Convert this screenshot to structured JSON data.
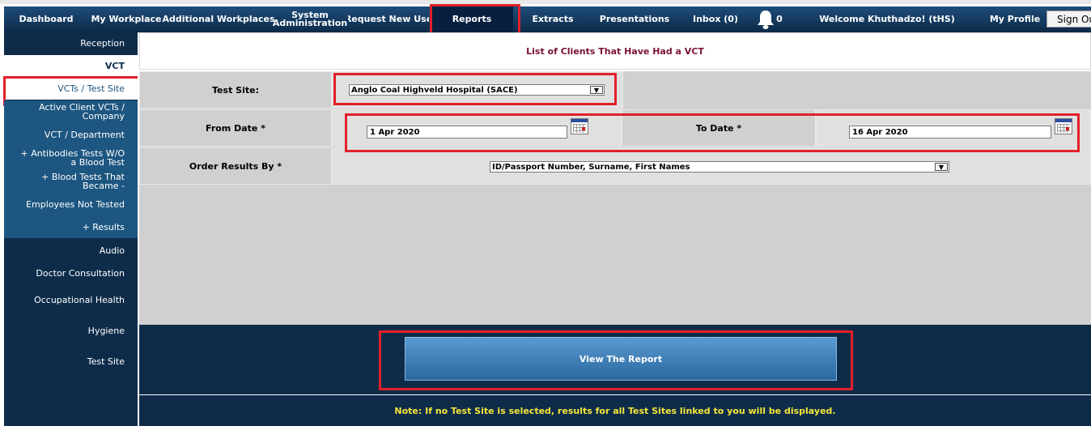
{
  "nav": {
    "items": [
      {
        "label": "Dashboard"
      },
      {
        "label": "My Workplace"
      },
      {
        "label": "Additional Workplaces"
      },
      {
        "label": "System Administration"
      },
      {
        "label": "Request New Use"
      },
      {
        "label": "Reports"
      },
      {
        "label": "Extracts"
      },
      {
        "label": "Presentations"
      },
      {
        "label": "Inbox (0)"
      },
      {
        "label": "0"
      },
      {
        "label": "Welcome Khuthadzo! (tHS)"
      },
      {
        "label": "My Profile"
      }
    ],
    "system_line1": "System",
    "system_line2": "Administration",
    "bell_count": "0",
    "signout": "Sign Ou"
  },
  "sidebar": {
    "items": [
      {
        "label": "Reception"
      },
      {
        "label": "VCT"
      },
      {
        "label": "VCTs / Test Site"
      },
      {
        "label": "Active Client VCTs / Company"
      },
      {
        "label": "VCT / Department"
      },
      {
        "label": "+ Antibodies Tests W/O a Blood Test"
      },
      {
        "label": "+ Blood Tests That Became -"
      },
      {
        "label": "Employees Not Tested"
      },
      {
        "label": "+ Results"
      },
      {
        "label": "Audio"
      },
      {
        "label": "Doctor Consultation"
      },
      {
        "label": "Occupational Health"
      },
      {
        "label": "Hygiene"
      },
      {
        "label": "Test Site"
      }
    ]
  },
  "report": {
    "title": "List of Clients That Have Had a VCT",
    "test_site_label": "Test Site:",
    "test_site_value": "Anglo Coal Highveld Hospital (SACE)",
    "from_date_label": "From Date *",
    "from_date_value": "1 Apr 2020",
    "to_date_label": "To Date *",
    "to_date_value": "16 Apr 2020",
    "order_label": "Order Results By *",
    "order_value": "ID/Passport Number, Surname, First Names",
    "view_button": "View The Report",
    "note": "Note: If no Test Site is selected, results for all Test Sites linked to you will be displayed."
  },
  "colors": {
    "nav_bg": "#0c2a48",
    "sidebar_bg": "#0e2c4a",
    "sidebar_sub_bg": "#1d5680",
    "highlight_red": "#e2202a",
    "note_text": "#f5e63a",
    "title_text": "#7a1232"
  }
}
